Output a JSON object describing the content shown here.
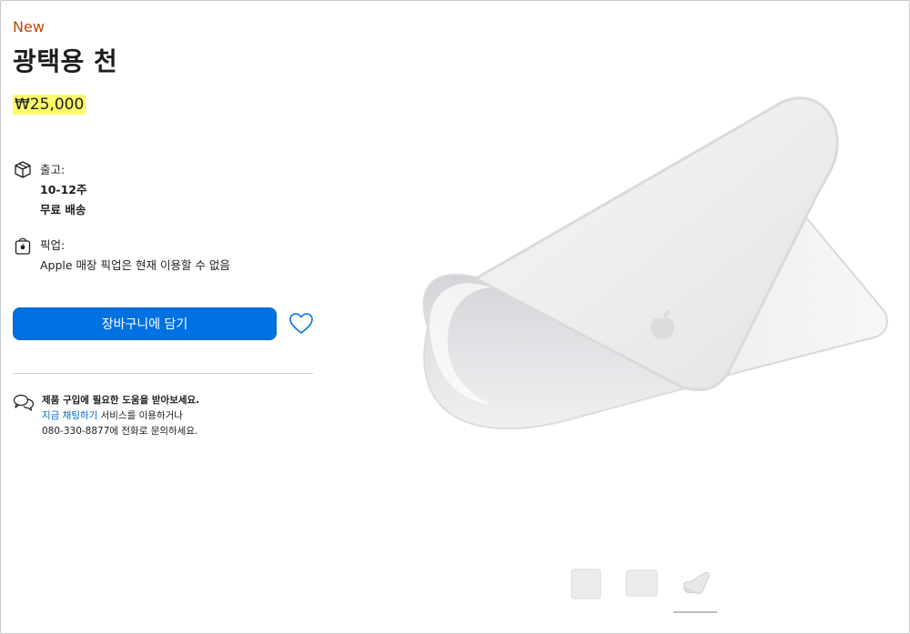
{
  "product": {
    "badge": "New",
    "title": "광택용 천",
    "price": "₩25,000"
  },
  "shipping": {
    "label": "출고:",
    "time": "10-12주",
    "cost": "무료 배송"
  },
  "pickup": {
    "label": "픽업:",
    "status": "Apple 매장 픽업은 현재 이용할 수 없음"
  },
  "actions": {
    "add_to_bag": "장바구니에 담기"
  },
  "help": {
    "heading": "제품 구입에 필요한 도움을 받아보세요.",
    "chat_link": "지금 채팅하기",
    "chat_suffix": " 서비스를 이용하거나",
    "phone_line": "080-330-8877에 전화로 문의하세요."
  },
  "gallery": {
    "thumbnail_count": 3,
    "active_index": 2
  },
  "colors": {
    "accent": "#0071e3",
    "badge": "#bf4800",
    "link": "#0066cc",
    "price_highlight": "#fdfc6b"
  },
  "icons": {
    "shipping": "box-icon",
    "pickup": "shopping-bag-icon",
    "favorite": "heart-icon",
    "help": "chat-bubbles-icon"
  }
}
